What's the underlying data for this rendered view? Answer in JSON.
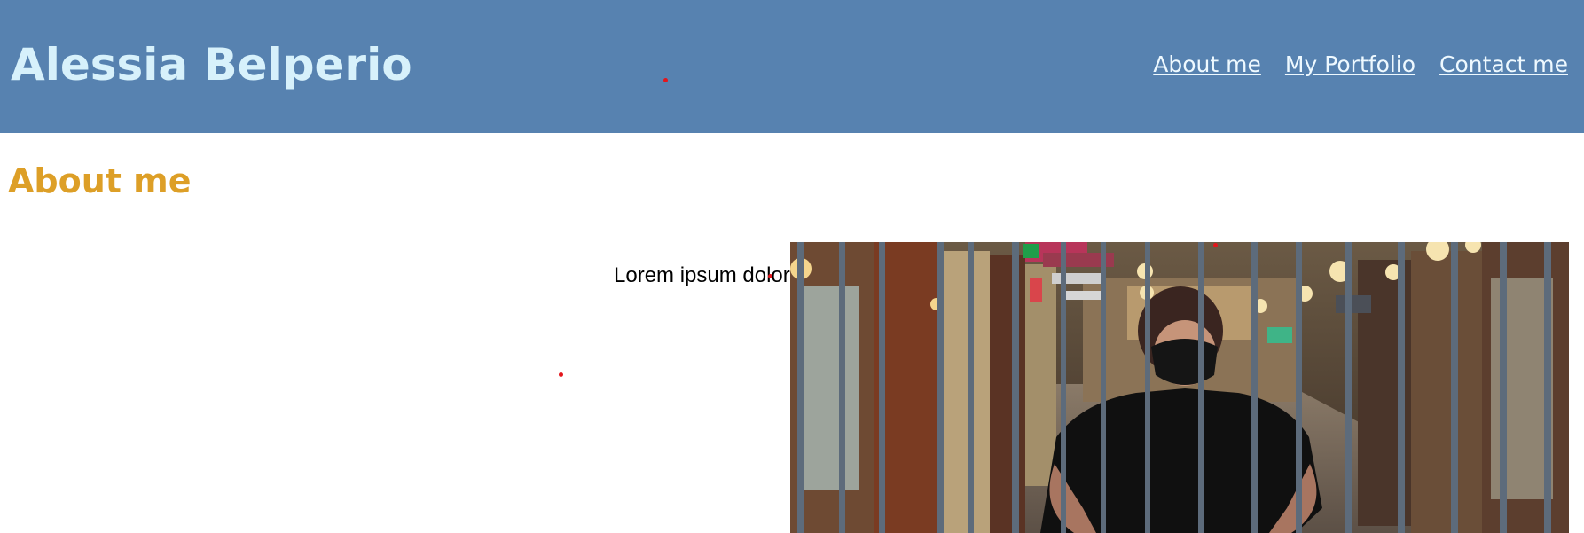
{
  "header": {
    "site_title": "Alessia Belperio",
    "nav": [
      "About me",
      "My Portfolio",
      "Contact me"
    ]
  },
  "main": {
    "section_title": "About me",
    "intro_text": "Lorem ipsum dolor",
    "photo": "photo"
  },
  "colors": {
    "header_bg": "#5782b0",
    "title": "#d7f1fb",
    "nav_link": "#eef9ff",
    "section_title": "#dd9f27",
    "body_text": "#000000",
    "marker": "#e3161c"
  }
}
